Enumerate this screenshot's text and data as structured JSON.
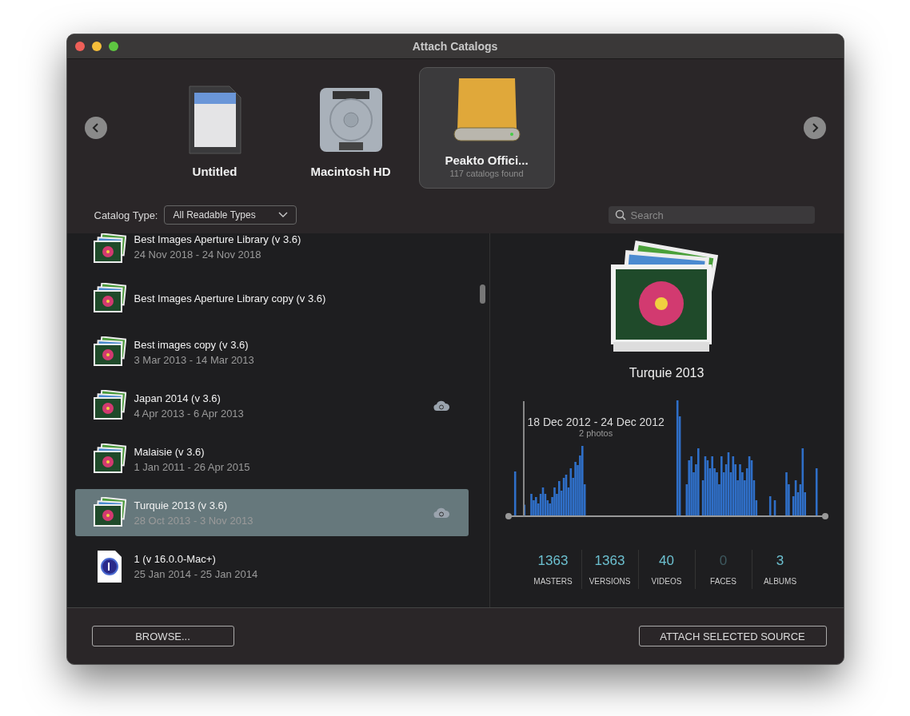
{
  "window": {
    "title": "Attach Catalogs"
  },
  "drives": [
    {
      "name": "Untitled",
      "kind": "sdcard",
      "selected": false
    },
    {
      "name": "Macintosh HD",
      "kind": "hdd",
      "selected": false
    },
    {
      "name": "Peakto Offici...",
      "kind": "external",
      "selected": true,
      "subtitle": "117 catalogs found"
    }
  ],
  "filter": {
    "label": "Catalog Type:",
    "value": "All Readable Types"
  },
  "search": {
    "placeholder": "Search"
  },
  "catalogs": [
    {
      "name": "Best Images Aperture Library (v 3.6)",
      "dates": "24 Nov 2018 - 24 Nov 2018",
      "kind": "aperture",
      "cloud": false,
      "selected": false
    },
    {
      "name": "Best Images Aperture Library copy (v 3.6)",
      "kind": "aperture",
      "cloud": false,
      "selected": false
    },
    {
      "name": "Best images copy (v 3.6)",
      "dates": "3 Mar 2013 - 14 Mar 2013",
      "kind": "aperture",
      "cloud": false,
      "selected": false
    },
    {
      "name": "Japan 2014 (v 3.6)",
      "dates": "4 Apr 2013 - 6 Apr 2013",
      "kind": "aperture",
      "cloud": true,
      "selected": false
    },
    {
      "name": "Malaisie (v 3.6)",
      "dates": "1 Jan 2011 - 26 Apr 2015",
      "kind": "aperture",
      "cloud": false,
      "selected": false
    },
    {
      "name": "Turquie 2013 (v 3.6)",
      "dates": "28 Oct 2013 - 3 Nov 2013",
      "kind": "aperture",
      "cloud": true,
      "selected": true
    },
    {
      "name": "1 (v 16.0.0-Mac+)",
      "dates": "25 Jan 2014 - 25 Jan 2014",
      "kind": "captureone",
      "cloud": false,
      "selected": false
    }
  ],
  "detail": {
    "title": "Turquie 2013",
    "hover_range": "18 Dec 2012 - 24 Dec 2012",
    "hover_count": "2 photos",
    "stats": [
      {
        "value": "1363",
        "label": "MASTERS",
        "disabled": false
      },
      {
        "value": "1363",
        "label": "VERSIONS",
        "disabled": false
      },
      {
        "value": "40",
        "label": "VIDEOS",
        "disabled": false
      },
      {
        "value": "0",
        "label": "FACES",
        "disabled": true
      },
      {
        "value": "3",
        "label": "ALBUMS",
        "disabled": false
      }
    ]
  },
  "buttons": {
    "browse": "BROWSE...",
    "attach": "ATTACH SELECTED SOURCE"
  }
}
